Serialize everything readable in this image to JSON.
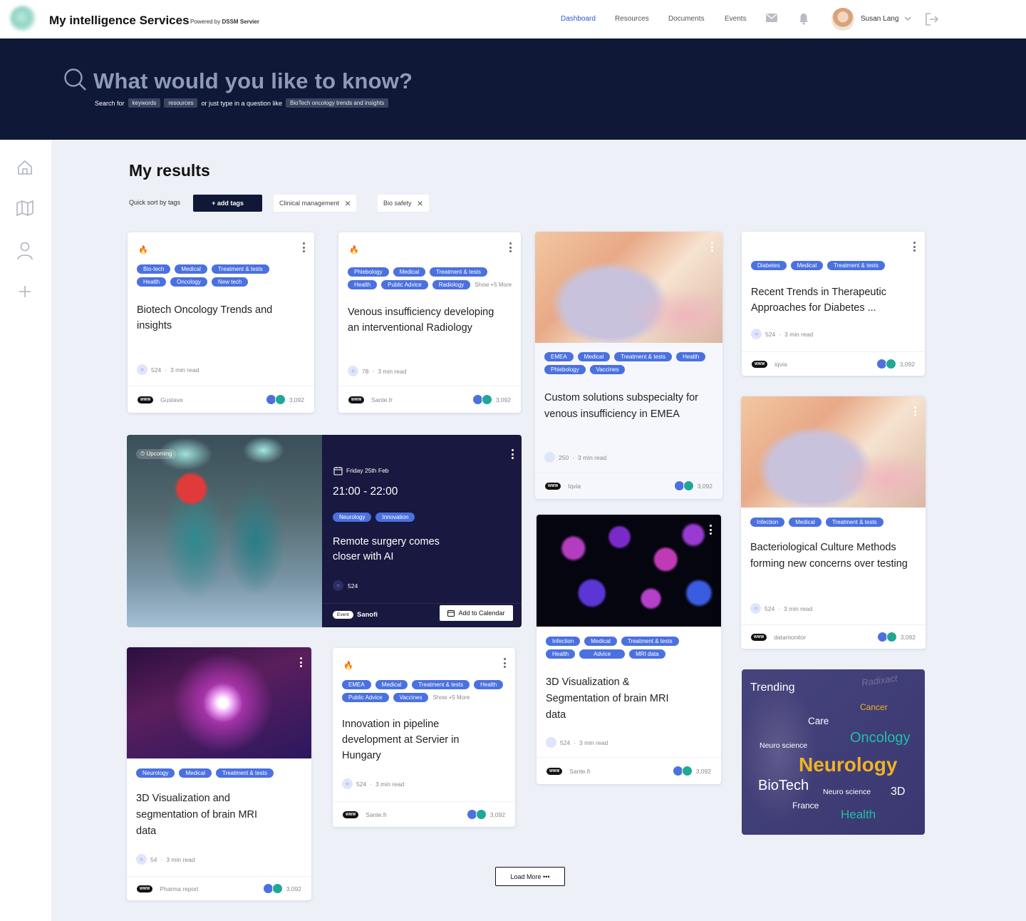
{
  "app": {
    "title": "My intelligence Services",
    "powered_prefix": "Powered by",
    "powered_brand": "DSSM Servier"
  },
  "nav": {
    "items": [
      "Dashboard",
      "Resources",
      "Documents",
      "Events"
    ],
    "active": "Dashboard"
  },
  "user": {
    "name": "Susan Lang"
  },
  "hero": {
    "question": "What would you like to know?",
    "hint_prefix": "Search for",
    "chip1": "keywords",
    "chip2": "resources",
    "hint_middle": "or just type in a question like",
    "chip3": "BioTech oncology trends and insights"
  },
  "results": {
    "title": "My results",
    "sort_label": "Quick sort by tags",
    "add_tags": "+ add tags",
    "filters": [
      "Clinical management",
      "Bio safety"
    ]
  },
  "cards": {
    "c1": {
      "tags": [
        "Bio-tech",
        "Medical",
        "Treatment & tests",
        "Health",
        "Oncology",
        "New tech"
      ],
      "title": "Biotech Oncology Trends and insights",
      "comments": "524",
      "read": "3 min read",
      "source": "Gustave",
      "count": "3,092"
    },
    "c2": {
      "tags": [
        "Phlebology",
        "Medical",
        "Treatment & tests",
        "Health",
        "Public Advice",
        "Radiology"
      ],
      "more": "Show +5 More",
      "title": "Venous insufficiency developing an interventional Radiology",
      "comments": "78",
      "read": "3 min read",
      "source": "Sante.fr",
      "count": "3,092"
    },
    "c3": {
      "tags": [
        "EMEA",
        "Medical",
        "Treatment & tests",
        "Health",
        "Phlebology",
        "Vaccines"
      ],
      "title": "Custom solutions subspecialty for venous insufficiency in EMEA",
      "comments": "250",
      "read": "3 min read",
      "source": "Iqvia",
      "count": "3,092"
    },
    "c4": {
      "tags": [
        "Diabetes",
        "Medical",
        "Treatment & tests"
      ],
      "title": "Recent Trends in Therapeutic Approaches for Diabetes ...",
      "comments": "524",
      "read": "3 min read",
      "source": "iqvia",
      "count": "3,092"
    },
    "c5": {
      "tags": [
        "Infection",
        "Medical",
        "Treatment & tests"
      ],
      "title": "Bacteriological Culture Methods forming new concerns over testing",
      "comments": "524",
      "read": "3 min read",
      "source": "datamonitor",
      "count": "3,092"
    },
    "c6": {
      "tags": [
        "Infection",
        "Medical",
        "Treatment & tests",
        "Health",
        "Advice",
        "MRI data"
      ],
      "title": "3D Visualization & Segmentation of brain MRI data",
      "comments": "524",
      "read": "3 min read",
      "source": "Sante.fr",
      "count": "3,092"
    },
    "c7": {
      "tags": [
        "Neurology",
        "Medical",
        "Treatment & tests"
      ],
      "title": "3D Visualization and segmentation of brain MRI data",
      "comments": "54",
      "read": "3 min read",
      "source": "Pharma report",
      "count": "3,092"
    },
    "c8": {
      "tags": [
        "EMEA",
        "Medical",
        "Treatment & tests",
        "Health",
        "Public Advice",
        "Vaccines"
      ],
      "more": "Show +5 More",
      "title": "Innovation in pipeline development at Servier in Hungary",
      "comments": "524",
      "read": "3 min read",
      "source": "Sante.fr",
      "count": "3,092"
    }
  },
  "event": {
    "status": "Upcoming",
    "date": "Friday 25th Feb",
    "time": "21:00 - 22:00",
    "tags": [
      "Neurology",
      "Innovation"
    ],
    "title": "Remote surgery comes closer with AI",
    "comments": "524",
    "badge": "Event",
    "org": "Sanofi",
    "cta": "Add to Calendar"
  },
  "trending": {
    "title": "Trending",
    "brand_watermark": "Radixact",
    "words": [
      "Cancer",
      "Care",
      "Oncology",
      "Neuro science",
      "Neurology",
      "BioTech",
      "Neuro science",
      "3D",
      "France",
      "Health"
    ]
  },
  "load_more": "Load More",
  "colors": {
    "navy": "#0f1836",
    "accent": "#2b57d6",
    "tag": "#4b71e0",
    "teal": "#1fa896",
    "gold": "#f0b323"
  }
}
